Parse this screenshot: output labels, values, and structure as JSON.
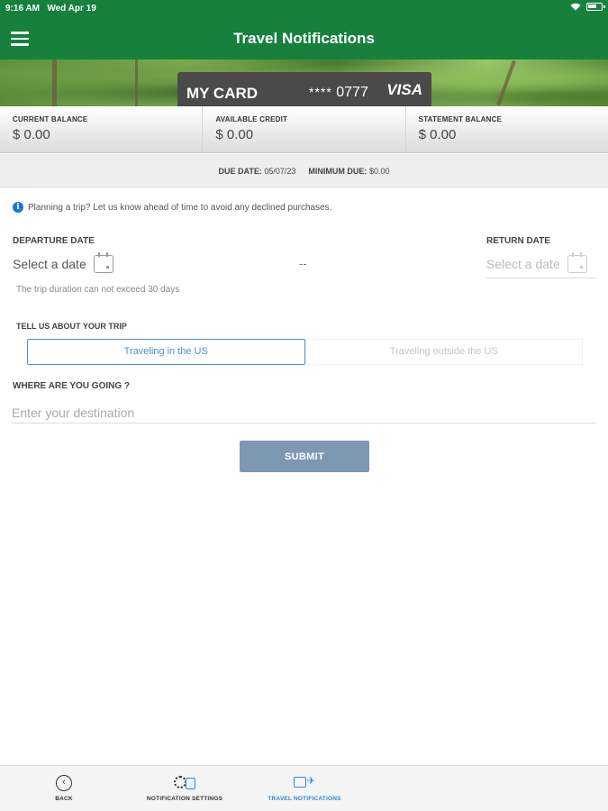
{
  "status": {
    "time": "9:16 AM",
    "date": "Wed Apr 19"
  },
  "header": {
    "title": "Travel Notifications"
  },
  "card": {
    "name": "MY CARD",
    "masked": "****",
    "last4": "0777",
    "brand": "VISA"
  },
  "balances": [
    {
      "label": "CURRENT BALANCE",
      "value": "$ 0.00"
    },
    {
      "label": "AVAILABLE CREDIT",
      "value": "$ 0.00"
    },
    {
      "label": "STATEMENT BALANCE",
      "value": "$ 0.00"
    }
  ],
  "due": {
    "due_label": "DUE DATE:",
    "due_value": "05/07/23",
    "min_label": "MINIMUM DUE:",
    "min_value": "$0.00"
  },
  "info": "Planning a trip? Let us know ahead of time to avoid any declined purchases.",
  "form": {
    "departure_label": "DEPARTURE DATE",
    "departure_value": "Select a date",
    "return_label": "RETURN DATE",
    "return_value": "Select a date",
    "separator": "--",
    "duration_hint": "The trip duration can not exceed 30 days",
    "trip_label": "TELL US ABOUT YOUR TRIP",
    "trip_options": [
      "Traveling in the US",
      "Traveling outside the US"
    ],
    "trip_selected": "Traveling in the US",
    "destination_label": "WHERE ARE YOU GOING ?",
    "destination_placeholder": "Enter your destination",
    "submit_label": "SUBMIT"
  },
  "tabs": [
    {
      "label": "BACK",
      "icon": "back-icon"
    },
    {
      "label": "NOTIFICATION SETTINGS",
      "icon": "notification-settings-icon"
    },
    {
      "label": "TRAVEL NOTIFICATIONS",
      "icon": "travel-notifications-icon",
      "active": true
    }
  ],
  "colors": {
    "brand_green": "#16803c",
    "accent_blue": "#4a8fd6",
    "submit": "#7c98b3"
  }
}
